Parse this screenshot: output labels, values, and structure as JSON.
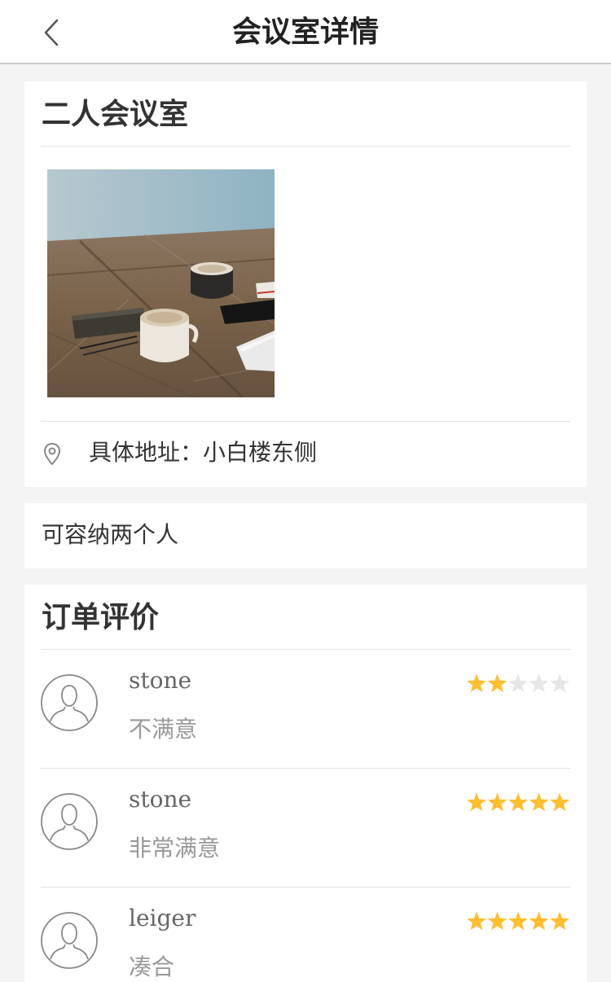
{
  "header": {
    "title": "会议室详情",
    "back_icon": "chevron-left-icon"
  },
  "room": {
    "name": "二人会议室",
    "photo": "coffee-cups-on-wooden-table",
    "address_label": "具体地址：",
    "address": "小白楼东侧",
    "location_icon": "map-pin-icon",
    "description": "可容纳两个人"
  },
  "reviews": {
    "title": "订单评价",
    "star_color": "#ffbe2e",
    "star_empty_color": "#e6e6e6",
    "items": [
      {
        "user": "stone",
        "comment": "不满意",
        "rating": 2,
        "max_rating": 5
      },
      {
        "user": "stone",
        "comment": "非常满意",
        "rating": 5,
        "max_rating": 5
      },
      {
        "user": "leiger",
        "comment": "凑合",
        "rating": 5,
        "max_rating": 5
      }
    ]
  }
}
